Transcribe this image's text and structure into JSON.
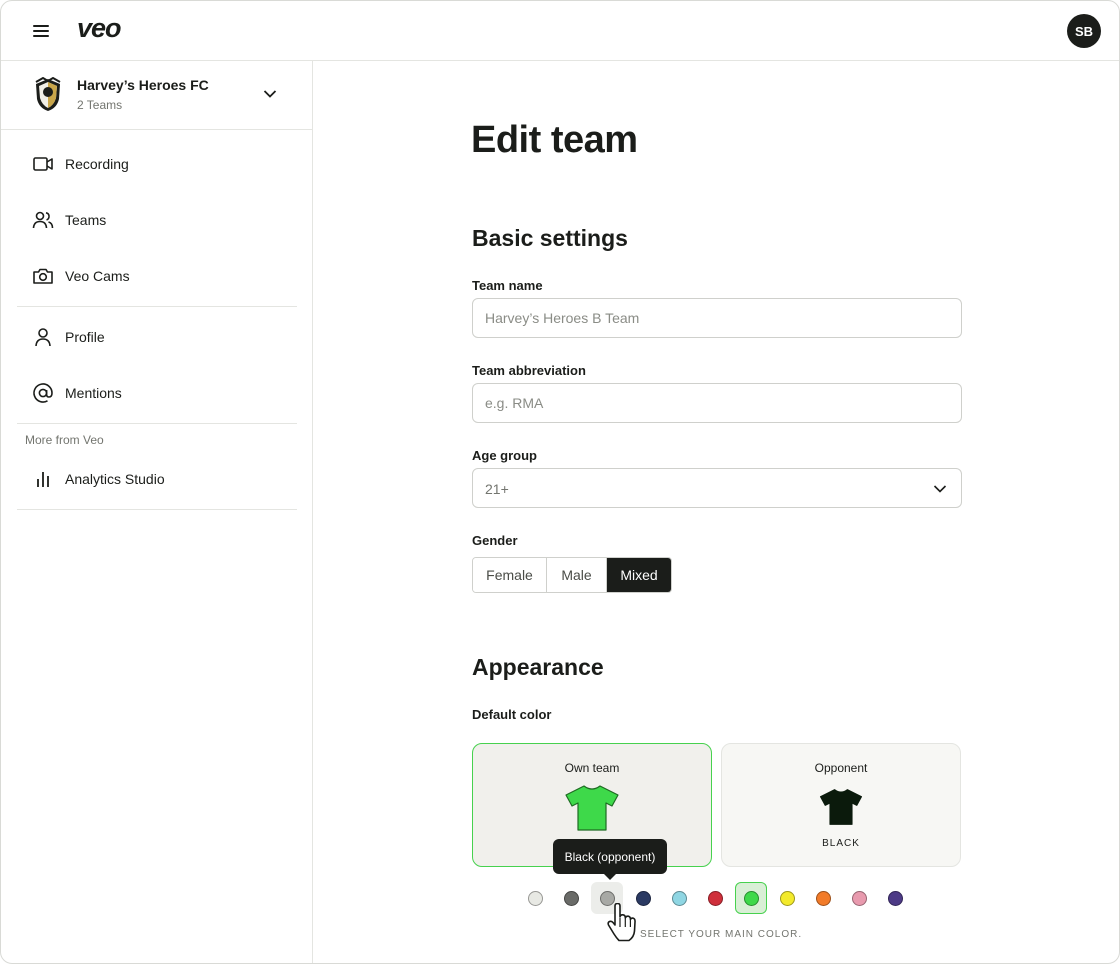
{
  "app": {
    "logo": "veo",
    "avatar_initials": "SB"
  },
  "sidebar": {
    "club": {
      "name": "Harvey’s Heroes FC",
      "subtitle": "2 Teams"
    },
    "items": [
      {
        "label": "Recording",
        "icon": "video-camera-icon"
      },
      {
        "label": "Teams",
        "icon": "users-icon"
      },
      {
        "label": "Veo Cams",
        "icon": "camera-icon"
      },
      {
        "label": "Profile",
        "icon": "user-icon"
      },
      {
        "label": "Mentions",
        "icon": "at-sign-icon"
      }
    ],
    "more_label": "More from Veo",
    "more_items": [
      {
        "label": "Analytics Studio",
        "icon": "bar-chart-icon"
      }
    ]
  },
  "main": {
    "title": "Edit team",
    "basic_settings": {
      "heading": "Basic settings",
      "team_name": {
        "label": "Team name",
        "value": "",
        "placeholder": "Harvey’s Heroes B Team"
      },
      "team_abbreviation": {
        "label": "Team abbreviation",
        "value": "",
        "placeholder": "e.g. RMA"
      },
      "age_group": {
        "label": "Age group",
        "value": "21+"
      },
      "gender": {
        "label": "Gender",
        "options": [
          "Female",
          "Male",
          "Mixed"
        ],
        "selected": "Mixed"
      }
    },
    "appearance": {
      "heading": "Appearance",
      "default_color_label": "Default color",
      "own_team": {
        "title": "Own team",
        "shirt_color": "#3ed94a",
        "icon": "shirt-icon"
      },
      "opponent": {
        "title": "Opponent",
        "color_name": "BLACK",
        "shirt_color": "#0b1a0c",
        "icon": "shirt-icon"
      },
      "tooltip": "Black (opponent)",
      "swatches": [
        {
          "color": "#e8e9e4",
          "state": ""
        },
        {
          "color": "#6a6b68",
          "state": ""
        },
        {
          "color": "#a8a9a5",
          "state": "hover"
        },
        {
          "color": "#2b3a63",
          "state": ""
        },
        {
          "color": "#8fd6e3",
          "state": ""
        },
        {
          "color": "#cf2f3b",
          "state": ""
        },
        {
          "color": "#3ed94a",
          "state": "selected"
        },
        {
          "color": "#f3ea2b",
          "state": ""
        },
        {
          "color": "#f27b29",
          "state": ""
        },
        {
          "color": "#e89aae",
          "state": ""
        },
        {
          "color": "#4d3a86",
          "state": ""
        }
      ],
      "hint": "SELECT YOUR MAIN COLOR."
    }
  }
}
